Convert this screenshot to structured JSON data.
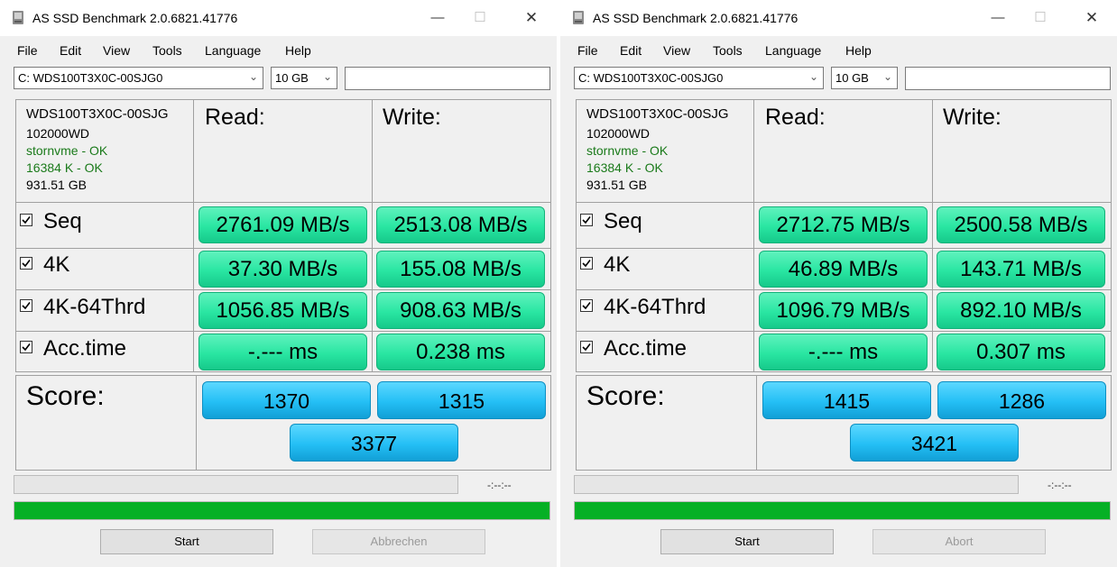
{
  "windows": [
    {
      "title": "AS SSD Benchmark 2.0.6821.41776",
      "menu": [
        "File",
        "Edit",
        "View",
        "Tools",
        "Language",
        "Help"
      ],
      "drive_select": "C: WDS100T3X0C-00SJG0",
      "size_select": "10 GB",
      "text_field": "",
      "info": {
        "model": "WDS100T3X0C-00SJG",
        "firmware": "102000WD",
        "driver": "stornvme - OK",
        "alignment": "16384 K - OK",
        "capacity": "931.51 GB"
      },
      "headers": {
        "read": "Read:",
        "write": "Write:"
      },
      "rows": [
        {
          "label": "Seq",
          "checked": true,
          "read": "2761.09 MB/s",
          "write": "2513.08 MB/s"
        },
        {
          "label": "4K",
          "checked": true,
          "read": "37.30 MB/s",
          "write": "155.08 MB/s"
        },
        {
          "label": "4K-64Thrd",
          "checked": true,
          "read": "1056.85 MB/s",
          "write": "908.63 MB/s"
        },
        {
          "label": "Acc.time",
          "checked": true,
          "read": "-.--- ms",
          "write": "0.238 ms"
        }
      ],
      "score": {
        "label": "Score:",
        "read": "1370",
        "write": "1315",
        "total": "3377"
      },
      "elapsed_time": "-:--:--",
      "progress": 1.0,
      "buttons": {
        "start": "Start",
        "abort": "Abbrechen"
      }
    },
    {
      "title": "AS SSD Benchmark 2.0.6821.41776",
      "menu": [
        "File",
        "Edit",
        "View",
        "Tools",
        "Language",
        "Help"
      ],
      "drive_select": "C: WDS100T3X0C-00SJG0",
      "size_select": "10 GB",
      "text_field": "",
      "info": {
        "model": "WDS100T3X0C-00SJG",
        "firmware": "102000WD",
        "driver": "stornvme - OK",
        "alignment": "16384 K - OK",
        "capacity": "931.51 GB"
      },
      "headers": {
        "read": "Read:",
        "write": "Write:"
      },
      "rows": [
        {
          "label": "Seq",
          "checked": true,
          "read": "2712.75 MB/s",
          "write": "2500.58 MB/s"
        },
        {
          "label": "4K",
          "checked": true,
          "read": "46.89 MB/s",
          "write": "143.71 MB/s"
        },
        {
          "label": "4K-64Thrd",
          "checked": true,
          "read": "1096.79 MB/s",
          "write": "892.10 MB/s"
        },
        {
          "label": "Acc.time",
          "checked": true,
          "read": "-.--- ms",
          "write": "0.307 ms"
        }
      ],
      "score": {
        "label": "Score:",
        "read": "1415",
        "write": "1286",
        "total": "3421"
      },
      "elapsed_time": "-:--:--",
      "progress": 1.0,
      "buttons": {
        "start": "Start",
        "abort": "Abort"
      }
    }
  ],
  "colors": {
    "result_green": "#29e6a2",
    "score_blue": "#24bff5",
    "progress_green": "#06b025",
    "ok_text": "#1a7a1a"
  },
  "icons": {
    "app": "drive-icon",
    "checkbox": "checkbox-checked-icon"
  }
}
